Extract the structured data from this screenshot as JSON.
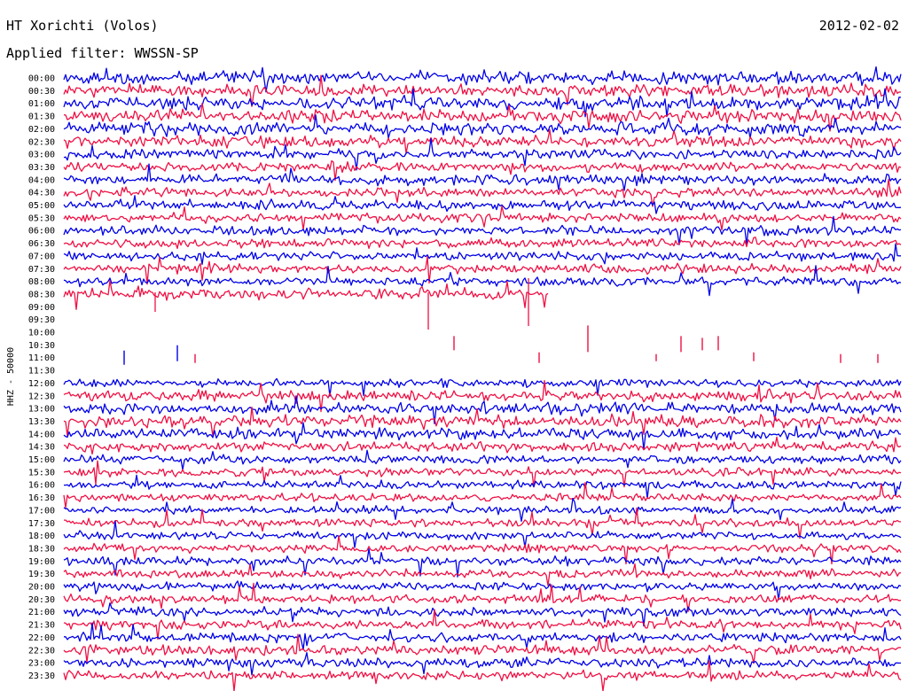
{
  "header": {
    "station": "HT Xorichti (Volos)",
    "filter": "Applied filter: WWSSN-SP",
    "date": "2012-02-02"
  },
  "chart_data": {
    "type": "line",
    "title": "HT Xorichti (Volos)",
    "subtitle": "Applied filter: WWSSN-SP",
    "ylabel": "HHZ - 50000",
    "trace_colors": [
      "#0000e6",
      "#ee1144"
    ],
    "rows": [
      "00:00",
      "00:30",
      "01:00",
      "01:30",
      "02:00",
      "02:30",
      "03:00",
      "03:30",
      "04:00",
      "04:30",
      "05:00",
      "05:30",
      "06:00",
      "06:30",
      "07:00",
      "07:30",
      "08:00",
      "08:30",
      "09:00",
      "09:30",
      "10:00",
      "10:30",
      "11:00",
      "11:30",
      "12:00",
      "12:30",
      "13:00",
      "13:30",
      "14:00",
      "14:30",
      "15:00",
      "15:30",
      "16:00",
      "16:30",
      "17:00",
      "17:30",
      "18:00",
      "18:30",
      "19:00",
      "19:30",
      "20:00",
      "20:30",
      "21:00",
      "21:30",
      "22:00",
      "22:30",
      "23:00",
      "23:30"
    ],
    "noise_amplitude": [
      0.8,
      0.8,
      0.85,
      0.85,
      0.85,
      0.7,
      0.65,
      0.6,
      0.65,
      0.6,
      0.65,
      0.6,
      0.6,
      0.6,
      0.6,
      0.6,
      0.55,
      0.5,
      0,
      0,
      0,
      0,
      0,
      0,
      0.5,
      0.7,
      0.75,
      0.8,
      0.7,
      0.65,
      0.55,
      0.55,
      0.5,
      0.5,
      0.5,
      0.5,
      0.5,
      0.5,
      0.55,
      0.55,
      0.55,
      0.55,
      0.6,
      0.6,
      0.6,
      0.6,
      0.6,
      0.6
    ],
    "gap": {
      "start": "08:30",
      "end": "12:00"
    }
  }
}
